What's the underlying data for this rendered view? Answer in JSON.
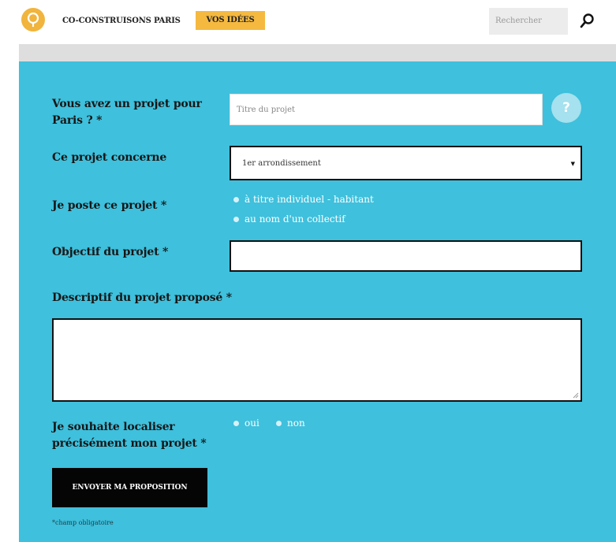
{
  "header": {
    "site_title": "CO-CONSTRUISONS PARIS",
    "nav_active": "VOS IDÉES",
    "search_placeholder": "Rechercher",
    "accent_color": "#f5b940"
  },
  "form": {
    "background_color": "#3fc0dc",
    "project_label": "Vous avez un projet pour Paris ? *",
    "project_placeholder": "Titre du projet",
    "help_label": "?",
    "concern_label": "Ce projet concerne",
    "concern_value": "1er arrondissement",
    "post_label": "Je poste ce projet *",
    "post_options": [
      "à titre individuel - habitant",
      "au nom d'un collectif"
    ],
    "objective_label": "Objectif du projet *",
    "objective_value": "",
    "description_label": "Descriptif du projet proposé *",
    "description_value": "",
    "locate_label": "Je souhaite localiser précisément mon projet *",
    "locate_options": [
      "oui",
      "non"
    ],
    "submit_label": "ENVOYER MA PROPOSITION",
    "required_note": "*champ obligatoire"
  },
  "icons": {
    "logo": "lightbulb-logo-icon",
    "search": "search-icon",
    "help": "help-icon",
    "select_arrow": "caret-down-icon"
  }
}
